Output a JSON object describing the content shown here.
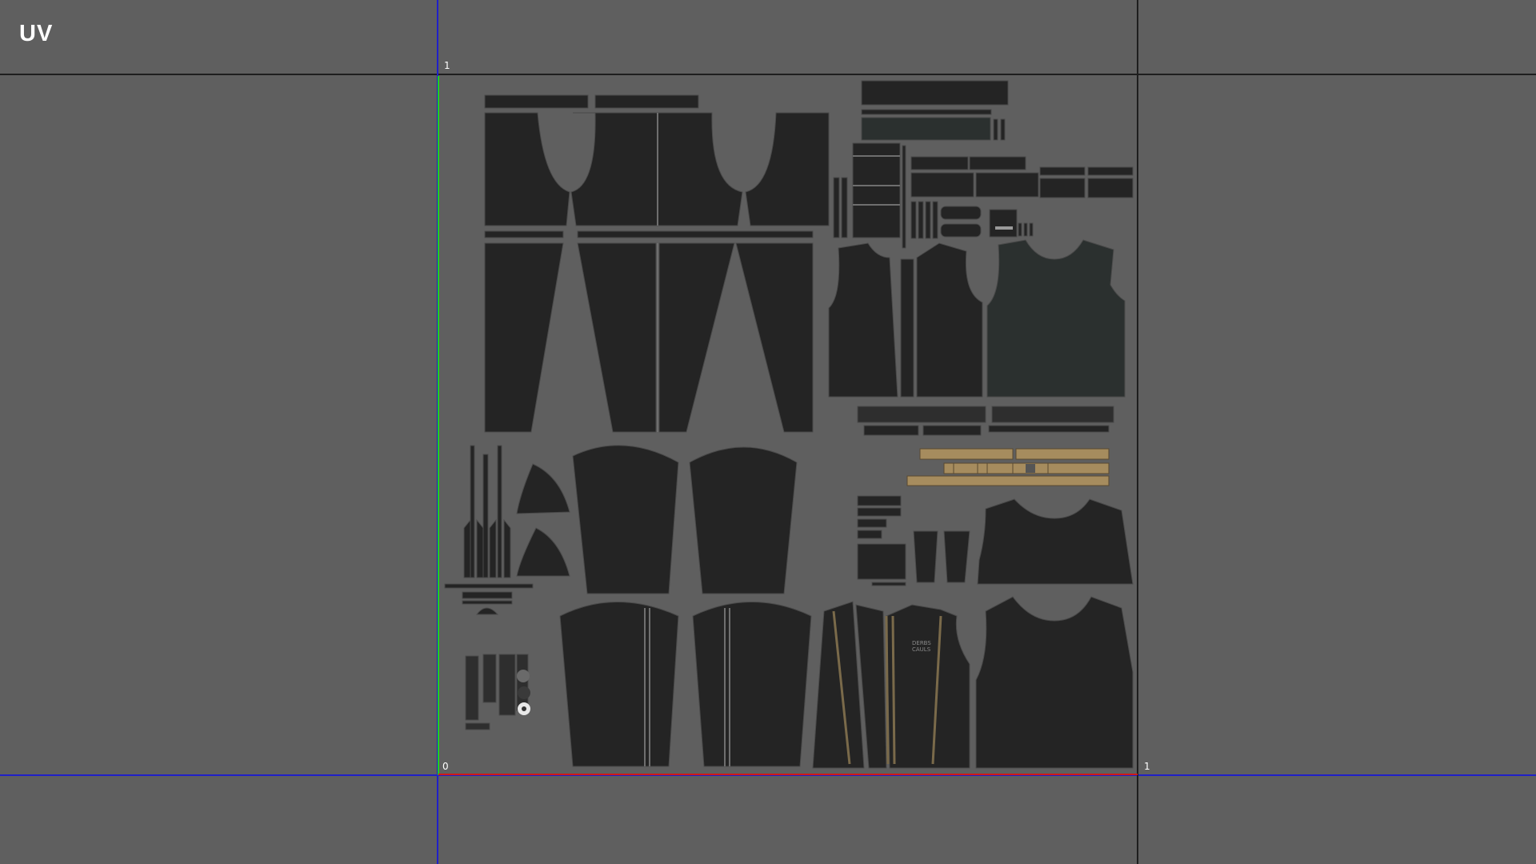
{
  "viewport": {
    "title": "UV",
    "tick_labels": {
      "v_top": "1",
      "origin": "0",
      "u_right": "1"
    },
    "fabric_labels": {
      "chest_print_line1": "DERBS",
      "chest_print_line2": "CAULS"
    }
  },
  "colors": {
    "background": "#5f5f5f",
    "grid_line": "#1e1e1e",
    "u_axis": "#d01818",
    "v_axis": "#20d020",
    "blue_line": "#2020c8",
    "shell_fill": "#242424",
    "shell_stroke": "#4a4a4a",
    "green_fill": "#2b302f",
    "leather_fill": "#a68c5e",
    "stitch": "#7a6a4a"
  }
}
